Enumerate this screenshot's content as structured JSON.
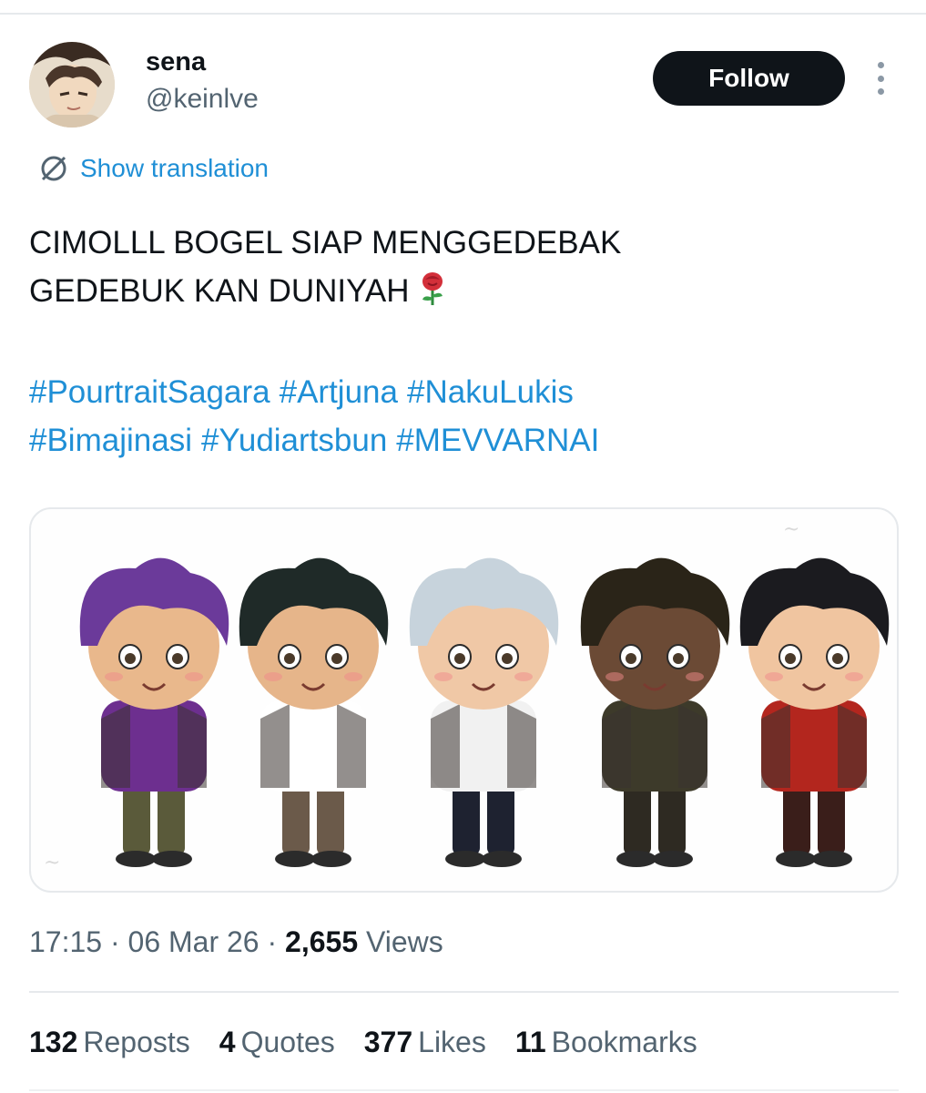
{
  "author": {
    "display_name": "sena",
    "handle": "@keinlve",
    "avatar_icon": "anime-portrait-avatar"
  },
  "actions": {
    "follow_label": "Follow",
    "more_icon": "vertical-ellipsis-icon"
  },
  "translation": {
    "label": "Show translation",
    "icon": "translate-globe-icon"
  },
  "tweet": {
    "lines": [
      "CIMOLLL BOGEL SIAP MENGGEDEBAK",
      "GEDEBUK KAN DUNIYAH"
    ],
    "emoji": "rose-emoji",
    "hashtags_row1": [
      "#PourtraitSagara",
      "#Artjuna",
      "#NakuLukis"
    ],
    "hashtags_row2": [
      "#Bimajinasi",
      "#Yudiartsbun",
      "#MEVVARNAI"
    ]
  },
  "media": {
    "description_icon": "chibi-characters-illustration",
    "characters": [
      {
        "hair": "#6b3a9a",
        "skin": "#e9b88c",
        "top": "#6d2f8f",
        "pants": "#5a5a3a"
      },
      {
        "hair": "#1f2a28",
        "skin": "#e6b58a",
        "top": "#ffffff",
        "pants": "#6b5a4a"
      },
      {
        "hair": "#c7d3dc",
        "skin": "#f0c8a6",
        "top": "#f1f1f1",
        "pants": "#1e2230"
      },
      {
        "hair": "#2a2418",
        "skin": "#6b4a35",
        "top": "#3d3a2a",
        "pants": "#2e2a22"
      },
      {
        "hair": "#1b1b1f",
        "skin": "#f0c5a0",
        "top": "#b3261e",
        "pants": "#3a1e1a"
      }
    ]
  },
  "meta": {
    "time": "17:15",
    "date": "06 Mar 26",
    "views_count": "2,655",
    "views_label": "Views"
  },
  "stats": [
    {
      "count": "132",
      "label": "Reposts"
    },
    {
      "count": "4",
      "label": "Quotes"
    },
    {
      "count": "377",
      "label": "Likes"
    },
    {
      "count": "11",
      "label": "Bookmarks"
    }
  ]
}
